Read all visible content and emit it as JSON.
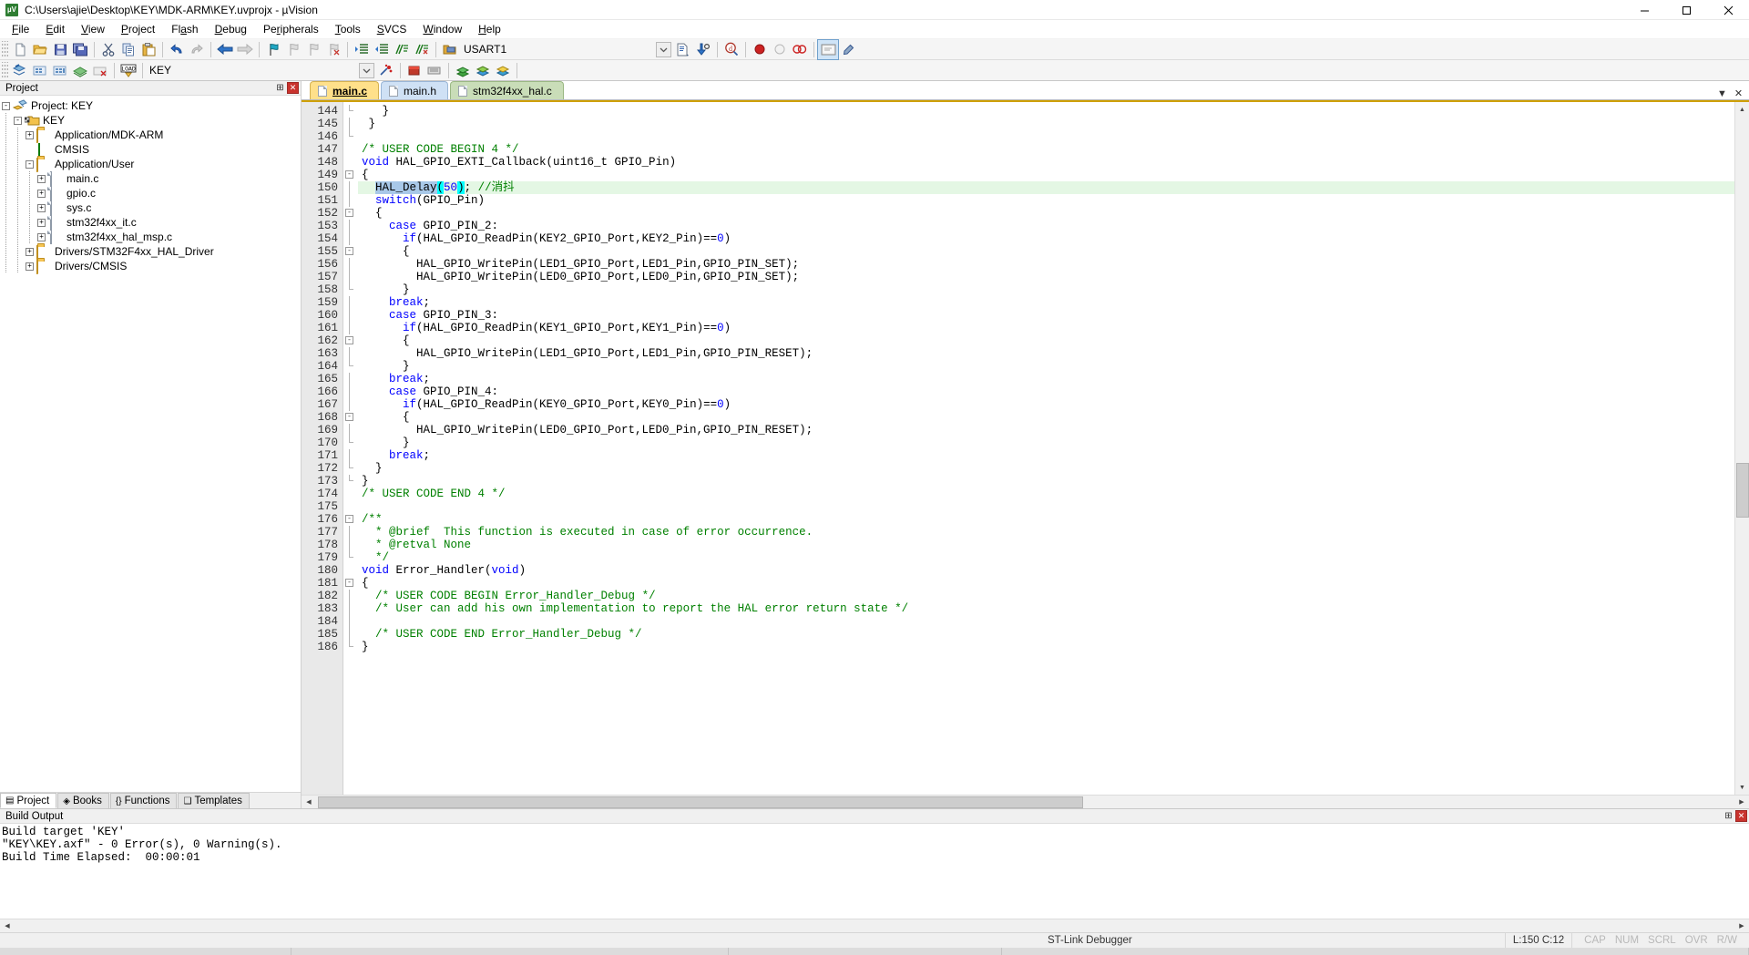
{
  "window": {
    "title": "C:\\Users\\ajie\\Desktop\\KEY\\MDK-ARM\\KEY.uvprojx - µVision",
    "app_icon_text": "µV",
    "minimize": "minimize-icon",
    "maximize": "maximize-icon",
    "close": "close-icon"
  },
  "menu": [
    {
      "label": "File"
    },
    {
      "label": "Edit"
    },
    {
      "label": "View"
    },
    {
      "label": "Project"
    },
    {
      "label": "Flash"
    },
    {
      "label": "Debug"
    },
    {
      "label": "Peripherals"
    },
    {
      "label": "Tools"
    },
    {
      "label": "SVCS"
    },
    {
      "label": "Window"
    },
    {
      "label": "Help"
    }
  ],
  "toolbar1": {
    "target_combo_value": "USART1",
    "buttons": [
      "new-file-icon",
      "open-file-icon",
      "save-icon",
      "save-all-icon",
      "cut-icon",
      "copy-icon",
      "paste-icon",
      "undo-icon",
      "redo-icon",
      "navigate-back-icon",
      "navigate-forward-icon",
      "bookmark-toggle-icon",
      "bookmark-prev-icon",
      "bookmark-next-icon",
      "bookmark-clear-icon",
      "indent-icon",
      "outdent-icon",
      "comment-icon",
      "uncomment-icon",
      "open-target-icon"
    ],
    "right_buttons": [
      "combo-dropdown-icon",
      "file-properties-icon",
      "find-in-files-icon",
      "bookmark-find-icon",
      "insert-breakpoint-icon",
      "disable-breakpoint-icon",
      "kill-breakpoints-icon",
      "debug-session-icon",
      "configure-icon"
    ]
  },
  "toolbar2": {
    "target_combo_value": "KEY",
    "buttons": [
      "translate-icon",
      "build-icon",
      "rebuild-icon",
      "batch-build-icon",
      "stop-build-icon",
      "download-icon"
    ],
    "right_buttons": [
      "target-options-icon",
      "manage-runtime-icon",
      "multi-project-icon",
      "books-icon",
      "functions-icon",
      "templates-icon"
    ]
  },
  "project_pane": {
    "header": "Project",
    "pin_icon": "pin-icon",
    "close_icon": "close-icon",
    "tree": [
      {
        "label": "Project: KEY",
        "depth": 0,
        "expander": "-",
        "icon": "project-icon"
      },
      {
        "label": "KEY",
        "depth": 1,
        "expander": "-",
        "icon": "target-folder-icon"
      },
      {
        "label": "Application/MDK-ARM",
        "depth": 2,
        "expander": "+",
        "icon": "group-folder-icon"
      },
      {
        "label": "CMSIS",
        "depth": 2,
        "expander": "",
        "icon": "cmsis-icon"
      },
      {
        "label": "Application/User",
        "depth": 2,
        "expander": "-",
        "icon": "group-folder-open-icon"
      },
      {
        "label": "main.c",
        "depth": 3,
        "expander": "+",
        "icon": "source-file-icon"
      },
      {
        "label": "gpio.c",
        "depth": 3,
        "expander": "+",
        "icon": "source-file-icon"
      },
      {
        "label": "sys.c",
        "depth": 3,
        "expander": "+",
        "icon": "source-file-icon"
      },
      {
        "label": "stm32f4xx_it.c",
        "depth": 3,
        "expander": "+",
        "icon": "source-file-icon"
      },
      {
        "label": "stm32f4xx_hal_msp.c",
        "depth": 3,
        "expander": "+",
        "icon": "source-file-icon"
      },
      {
        "label": "Drivers/STM32F4xx_HAL_Driver",
        "depth": 2,
        "expander": "+",
        "icon": "group-folder-icon"
      },
      {
        "label": "Drivers/CMSIS",
        "depth": 2,
        "expander": "+",
        "icon": "group-folder-icon"
      }
    ],
    "tabs": [
      {
        "label": "Project",
        "icon": "project-tab-icon",
        "active": true
      },
      {
        "label": "Books",
        "icon": "books-tab-icon",
        "active": false
      },
      {
        "label": "Functions",
        "icon": "functions-tab-icon",
        "active": false
      },
      {
        "label": "Templates",
        "icon": "templates-tab-icon",
        "active": false
      }
    ]
  },
  "editor": {
    "tabs": [
      {
        "label": "main.c",
        "active": true
      },
      {
        "label": "main.h",
        "active": false
      },
      {
        "label": "stm32f4xx_hal.c",
        "active": false
      }
    ],
    "tab_menu_icon": "tab-list-icon",
    "tab_close_icon": "close-icon",
    "first_line": 144,
    "lines": [
      {
        "n": 144,
        "fold": "end",
        "html": "   }"
      },
      {
        "n": 145,
        "fold": "line",
        "html": " }"
      },
      {
        "n": 146,
        "fold": "tail",
        "html": ""
      },
      {
        "n": 147,
        "fold": "",
        "html": "<span class=\"cm\">/* USER CODE BEGIN 4 */</span>"
      },
      {
        "n": 148,
        "fold": "",
        "html": "<span class=\"kw\">void</span> HAL_GPIO_EXTI_Callback(uint16_t GPIO_Pin)"
      },
      {
        "n": 149,
        "fold": "box",
        "html": "{"
      },
      {
        "n": 150,
        "fold": "line",
        "hl": true,
        "html": "  <span class=\"sel\">HAL_Delay</span><span class=\"br\">(</span><span class=\"num\">50</span><span class=\"br\">)</span>; <span class=\"cm\">//消抖</span>"
      },
      {
        "n": 151,
        "fold": "line",
        "html": "  <span class=\"kw\">switch</span>(GPIO_Pin)"
      },
      {
        "n": 152,
        "fold": "box",
        "html": "  {"
      },
      {
        "n": 153,
        "fold": "line",
        "html": "    <span class=\"kw\">case</span> GPIO_PIN_2:"
      },
      {
        "n": 154,
        "fold": "line",
        "html": "      <span class=\"kw\">if</span>(HAL_GPIO_ReadPin(KEY2_GPIO_Port,KEY2_Pin)==<span class=\"num\">0</span>)"
      },
      {
        "n": 155,
        "fold": "box",
        "html": "      {"
      },
      {
        "n": 156,
        "fold": "line",
        "html": "        HAL_GPIO_WritePin(LED1_GPIO_Port,LED1_Pin,GPIO_PIN_SET);"
      },
      {
        "n": 157,
        "fold": "line",
        "html": "        HAL_GPIO_WritePin(LED0_GPIO_Port,LED0_Pin,GPIO_PIN_SET);"
      },
      {
        "n": 158,
        "fold": "end",
        "html": "      }"
      },
      {
        "n": 159,
        "fold": "line",
        "html": "    <span class=\"kw\">break</span>;"
      },
      {
        "n": 160,
        "fold": "line",
        "html": "    <span class=\"kw\">case</span> GPIO_PIN_3:"
      },
      {
        "n": 161,
        "fold": "line",
        "html": "      <span class=\"kw\">if</span>(HAL_GPIO_ReadPin(KEY1_GPIO_Port,KEY1_Pin)==<span class=\"num\">0</span>)"
      },
      {
        "n": 162,
        "fold": "box",
        "html": "      {"
      },
      {
        "n": 163,
        "fold": "line",
        "html": "        HAL_GPIO_WritePin(LED1_GPIO_Port,LED1_Pin,GPIO_PIN_RESET);"
      },
      {
        "n": 164,
        "fold": "end",
        "html": "      }"
      },
      {
        "n": 165,
        "fold": "line",
        "html": "    <span class=\"kw\">break</span>;"
      },
      {
        "n": 166,
        "fold": "line",
        "html": "    <span class=\"kw\">case</span> GPIO_PIN_4:"
      },
      {
        "n": 167,
        "fold": "line",
        "html": "      <span class=\"kw\">if</span>(HAL_GPIO_ReadPin(KEY0_GPIO_Port,KEY0_Pin)==<span class=\"num\">0</span>)"
      },
      {
        "n": 168,
        "fold": "box",
        "html": "      {"
      },
      {
        "n": 169,
        "fold": "line",
        "html": "        HAL_GPIO_WritePin(LED0_GPIO_Port,LED0_Pin,GPIO_PIN_RESET);"
      },
      {
        "n": 170,
        "fold": "end",
        "html": "      }"
      },
      {
        "n": 171,
        "fold": "line",
        "html": "    <span class=\"kw\">break</span>;"
      },
      {
        "n": 172,
        "fold": "end",
        "html": "  }"
      },
      {
        "n": 173,
        "fold": "end",
        "html": "}"
      },
      {
        "n": 174,
        "fold": "",
        "html": "<span class=\"cm\">/* USER CODE END 4 */</span>"
      },
      {
        "n": 175,
        "fold": "",
        "html": ""
      },
      {
        "n": 176,
        "fold": "box",
        "html": "<span class=\"cm\">/**</span>"
      },
      {
        "n": 177,
        "fold": "line",
        "html": "  <span class=\"cm\">* @brief  This function is executed in case of error occurrence.</span>"
      },
      {
        "n": 178,
        "fold": "line",
        "html": "  <span class=\"cm\">* @retval None</span>"
      },
      {
        "n": 179,
        "fold": "end",
        "html": "  <span class=\"cm\">*/</span>"
      },
      {
        "n": 180,
        "fold": "",
        "html": "<span class=\"kw\">void</span> Error_Handler(<span class=\"kw\">void</span>)"
      },
      {
        "n": 181,
        "fold": "box",
        "html": "{"
      },
      {
        "n": 182,
        "fold": "line",
        "html": "  <span class=\"cm\">/* USER CODE BEGIN Error_Handler_Debug */</span>"
      },
      {
        "n": 183,
        "fold": "line",
        "html": "  <span class=\"cm\">/* User can add his own implementation to report the HAL error return state */</span>"
      },
      {
        "n": 184,
        "fold": "line",
        "html": ""
      },
      {
        "n": 185,
        "fold": "line",
        "html": "  <span class=\"cm\">/* USER CODE END Error_Handler_Debug */</span>"
      },
      {
        "n": 186,
        "fold": "end",
        "html": "}"
      }
    ]
  },
  "build_output": {
    "header": "Build Output",
    "pin_icon": "pin-icon",
    "close_icon": "close-icon",
    "lines": [
      "Build target 'KEY'",
      "\"KEY\\KEY.axf\" - 0 Error(s), 0 Warning(s).",
      "Build Time Elapsed:  00:00:01"
    ]
  },
  "status_bar": {
    "debugger": "ST-Link Debugger",
    "position": "L:150 C:12",
    "flags": [
      "CAP",
      "NUM",
      "SCRL",
      "OVR",
      "R/W"
    ]
  }
}
